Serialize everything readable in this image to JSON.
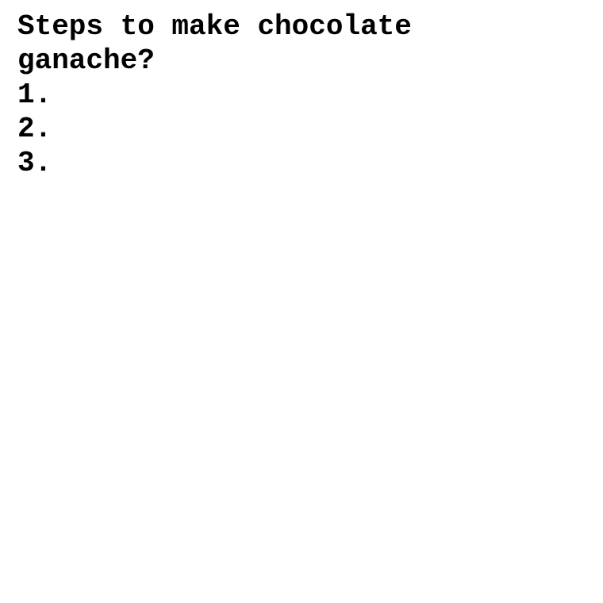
{
  "document": {
    "title": "Steps to make chocolate ganache?",
    "steps": [
      {
        "number": "1.",
        "text": ""
      },
      {
        "number": "2.",
        "text": ""
      },
      {
        "number": "3.",
        "text": ""
      }
    ]
  },
  "colors": {
    "background": "#ffffff",
    "text": "#000000"
  }
}
